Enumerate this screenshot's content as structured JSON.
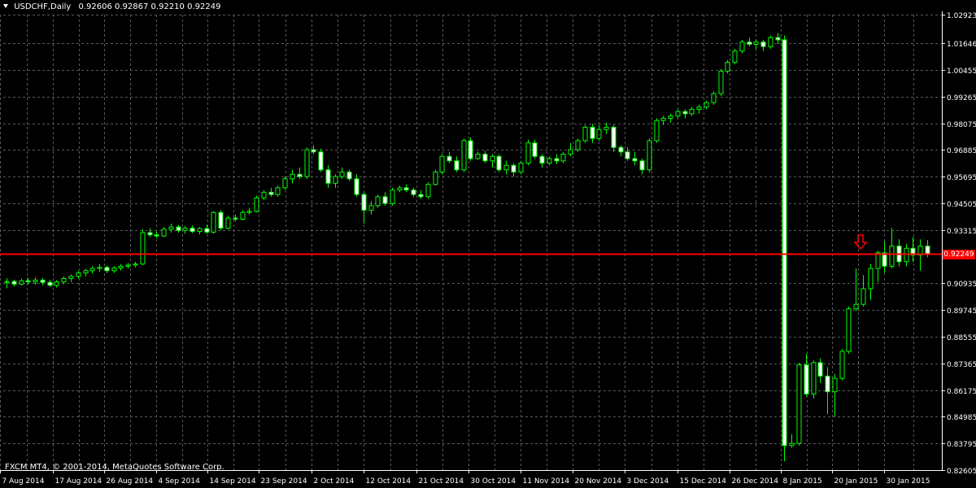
{
  "header": {
    "symbol": "USDCHF,Daily",
    "ohlc": "0.92606 0.92867 0.92210 0.92249"
  },
  "footer": {
    "copyright": "FXCM MT4, © 2001-2014, MetaQuotes Software Corp."
  },
  "colors": {
    "background": "#000000",
    "grid": "#5a5a5a",
    "candle": "#00ff00",
    "bull_body": "#000000",
    "bear_body": "#ffffff",
    "price_line": "#ff0000"
  },
  "price_tag": "0.92249",
  "chart_data": {
    "type": "candlestick",
    "title": "USDCHF,Daily",
    "ylim": [
      0.82605,
      1.02923
    ],
    "y_ticks": [
      "1.02923",
      "1.01646",
      "1.00455",
      "0.99265",
      "0.98075",
      "0.96885",
      "0.95695",
      "0.94505",
      "0.93315",
      "0.92249",
      "0.90935",
      "0.89745",
      "0.88555",
      "0.87365",
      "0.86175",
      "0.84985",
      "0.83795",
      "0.82605"
    ],
    "x_ticks": [
      "7 Aug 2014",
      "17 Aug 2014",
      "26 Aug 2014",
      "4 Sep 2014",
      "14 Sep 2014",
      "23 Sep 2014",
      "2 Oct 2014",
      "12 Oct 2014",
      "21 Oct 2014",
      "30 Oct 2014",
      "11 Nov 2014",
      "20 Nov 2014",
      "3 Dec 2014",
      "15 Dec 2014",
      "26 Dec 2014",
      "8 Jan 2015",
      "20 Jan 2015",
      "30 Jan 2015"
    ],
    "current_price": 0.92249,
    "grid": true,
    "candles": [
      [
        0.9098,
        0.9117,
        0.9072,
        0.9102
      ],
      [
        0.9102,
        0.911,
        0.908,
        0.909
      ],
      [
        0.909,
        0.9115,
        0.9085,
        0.9105
      ],
      [
        0.9105,
        0.9118,
        0.909,
        0.91
      ],
      [
        0.91,
        0.912,
        0.9088,
        0.9108
      ],
      [
        0.9108,
        0.9117,
        0.9085,
        0.9098
      ],
      [
        0.9098,
        0.911,
        0.9078,
        0.9085
      ],
      [
        0.9085,
        0.9108,
        0.9075,
        0.91
      ],
      [
        0.91,
        0.9125,
        0.909,
        0.9115
      ],
      [
        0.9115,
        0.9133,
        0.91,
        0.9125
      ],
      [
        0.9125,
        0.915,
        0.9115,
        0.914
      ],
      [
        0.914,
        0.916,
        0.9125,
        0.915
      ],
      [
        0.915,
        0.917,
        0.9138,
        0.916
      ],
      [
        0.916,
        0.918,
        0.9145,
        0.9165
      ],
      [
        0.9165,
        0.9173,
        0.914,
        0.915
      ],
      [
        0.915,
        0.917,
        0.914,
        0.9162
      ],
      [
        0.9162,
        0.918,
        0.915,
        0.917
      ],
      [
        0.917,
        0.9185,
        0.916,
        0.9175
      ],
      [
        0.9175,
        0.919,
        0.9165,
        0.918
      ],
      [
        0.918,
        0.9335,
        0.9175,
        0.932
      ],
      [
        0.932,
        0.934,
        0.93,
        0.931
      ],
      [
        0.931,
        0.9325,
        0.9295,
        0.9305
      ],
      [
        0.9305,
        0.9345,
        0.93,
        0.9335
      ],
      [
        0.9335,
        0.936,
        0.932,
        0.9345
      ],
      [
        0.9345,
        0.9355,
        0.932,
        0.933
      ],
      [
        0.933,
        0.935,
        0.9315,
        0.934
      ],
      [
        0.934,
        0.9352,
        0.9318,
        0.9325
      ],
      [
        0.9325,
        0.9345,
        0.9312,
        0.9338
      ],
      [
        0.9338,
        0.9355,
        0.9315,
        0.9322
      ],
      [
        0.9322,
        0.9415,
        0.9315,
        0.941
      ],
      [
        0.941,
        0.942,
        0.933,
        0.934
      ],
      [
        0.934,
        0.9395,
        0.9335,
        0.9385
      ],
      [
        0.9385,
        0.94,
        0.937,
        0.938
      ],
      [
        0.938,
        0.942,
        0.9375,
        0.941
      ],
      [
        0.941,
        0.943,
        0.94,
        0.9415
      ],
      [
        0.9415,
        0.9485,
        0.941,
        0.9475
      ],
      [
        0.9475,
        0.951,
        0.9465,
        0.95
      ],
      [
        0.95,
        0.952,
        0.948,
        0.949
      ],
      [
        0.949,
        0.953,
        0.948,
        0.952
      ],
      [
        0.952,
        0.957,
        0.951,
        0.956
      ],
      [
        0.956,
        0.96,
        0.954,
        0.958
      ],
      [
        0.958,
        0.961,
        0.956,
        0.957
      ],
      [
        0.957,
        0.97,
        0.956,
        0.969
      ],
      [
        0.969,
        0.971,
        0.967,
        0.968
      ],
      [
        0.968,
        0.9695,
        0.959,
        0.96
      ],
      [
        0.96,
        0.962,
        0.952,
        0.954
      ],
      [
        0.954,
        0.958,
        0.952,
        0.957
      ],
      [
        0.957,
        0.961,
        0.956,
        0.959
      ],
      [
        0.959,
        0.96,
        0.955,
        0.956
      ],
      [
        0.956,
        0.958,
        0.948,
        0.949
      ],
      [
        0.949,
        0.95,
        0.936,
        0.942
      ],
      [
        0.942,
        0.946,
        0.94,
        0.944
      ],
      [
        0.944,
        0.949,
        0.943,
        0.948
      ],
      [
        0.948,
        0.95,
        0.944,
        0.945
      ],
      [
        0.945,
        0.952,
        0.944,
        0.951
      ],
      [
        0.951,
        0.953,
        0.95,
        0.952
      ],
      [
        0.952,
        0.9535,
        0.95,
        0.951
      ],
      [
        0.951,
        0.952,
        0.948,
        0.949
      ],
      [
        0.949,
        0.951,
        0.947,
        0.948
      ],
      [
        0.948,
        0.9545,
        0.947,
        0.9535
      ],
      [
        0.9535,
        0.96,
        0.953,
        0.959
      ],
      [
        0.959,
        0.967,
        0.958,
        0.966
      ],
      [
        0.966,
        0.968,
        0.963,
        0.964
      ],
      [
        0.964,
        0.966,
        0.959,
        0.96
      ],
      [
        0.96,
        0.974,
        0.959,
        0.973
      ],
      [
        0.973,
        0.9745,
        0.964,
        0.965
      ],
      [
        0.965,
        0.968,
        0.9645,
        0.967
      ],
      [
        0.967,
        0.9685,
        0.963,
        0.964
      ],
      [
        0.964,
        0.967,
        0.961,
        0.966
      ],
      [
        0.966,
        0.967,
        0.959,
        0.96
      ],
      [
        0.96,
        0.964,
        0.958,
        0.962
      ],
      [
        0.962,
        0.963,
        0.957,
        0.959
      ],
      [
        0.959,
        0.964,
        0.958,
        0.963
      ],
      [
        0.963,
        0.9735,
        0.962,
        0.972
      ],
      [
        0.972,
        0.9735,
        0.965,
        0.966
      ],
      [
        0.966,
        0.967,
        0.961,
        0.963
      ],
      [
        0.963,
        0.966,
        0.962,
        0.965
      ],
      [
        0.965,
        0.967,
        0.9625,
        0.964
      ],
      [
        0.964,
        0.968,
        0.963,
        0.967
      ],
      [
        0.967,
        0.972,
        0.966,
        0.969
      ],
      [
        0.969,
        0.974,
        0.968,
        0.973
      ],
      [
        0.973,
        0.98,
        0.972,
        0.979
      ],
      [
        0.979,
        0.9805,
        0.972,
        0.974
      ],
      [
        0.974,
        0.98,
        0.973,
        0.978
      ],
      [
        0.978,
        0.981,
        0.976,
        0.979
      ],
      [
        0.979,
        0.98,
        0.968,
        0.97
      ],
      [
        0.97,
        0.971,
        0.966,
        0.968
      ],
      [
        0.968,
        0.97,
        0.964,
        0.965
      ],
      [
        0.965,
        0.968,
        0.962,
        0.964
      ],
      [
        0.964,
        0.965,
        0.958,
        0.96
      ],
      [
        0.96,
        0.974,
        0.959,
        0.973
      ],
      [
        0.973,
        0.983,
        0.972,
        0.982
      ],
      [
        0.982,
        0.984,
        0.98,
        0.983
      ],
      [
        0.983,
        0.985,
        0.981,
        0.984
      ],
      [
        0.984,
        0.987,
        0.983,
        0.986
      ],
      [
        0.986,
        0.987,
        0.983,
        0.985
      ],
      [
        0.985,
        0.988,
        0.984,
        0.987
      ],
      [
        0.987,
        0.989,
        0.985,
        0.988
      ],
      [
        0.988,
        0.991,
        0.987,
        0.99
      ],
      [
        0.99,
        0.995,
        0.989,
        0.994
      ],
      [
        0.994,
        1.005,
        0.993,
        1.004
      ],
      [
        1.004,
        1.009,
        1.003,
        1.008
      ],
      [
        1.008,
        1.014,
        1.007,
        1.013
      ],
      [
        1.013,
        1.018,
        1.012,
        1.017
      ],
      [
        1.017,
        1.019,
        1.015,
        1.016
      ],
      [
        1.016,
        1.018,
        1.014,
        1.017
      ],
      [
        1.017,
        1.018,
        1.013,
        1.015
      ],
      [
        1.015,
        1.02,
        1.014,
        1.019
      ],
      [
        1.019,
        1.021,
        1.016,
        1.018
      ],
      [
        1.018,
        1.02,
        0.83,
        0.837
      ],
      [
        0.837,
        0.842,
        0.836,
        0.838
      ],
      [
        0.838,
        0.874,
        0.837,
        0.873
      ],
      [
        0.873,
        0.878,
        0.859,
        0.86
      ],
      [
        0.86,
        0.875,
        0.858,
        0.874
      ],
      [
        0.874,
        0.876,
        0.865,
        0.868
      ],
      [
        0.868,
        0.872,
        0.851,
        0.861
      ],
      [
        0.861,
        0.869,
        0.85,
        0.867
      ],
      [
        0.867,
        0.88,
        0.866,
        0.879
      ],
      [
        0.879,
        0.899,
        0.878,
        0.898
      ],
      [
        0.898,
        0.916,
        0.897,
        0.9
      ],
      [
        0.9,
        0.913,
        0.899,
        0.907
      ],
      [
        0.907,
        0.918,
        0.902,
        0.916
      ],
      [
        0.916,
        0.924,
        0.91,
        0.923
      ],
      [
        0.923,
        0.928,
        0.914,
        0.917
      ],
      [
        0.917,
        0.934,
        0.916,
        0.926
      ],
      [
        0.926,
        0.929,
        0.917,
        0.919
      ],
      [
        0.919,
        0.927,
        0.917,
        0.925
      ],
      [
        0.925,
        0.93,
        0.919,
        0.922
      ],
      [
        0.922,
        0.929,
        0.915,
        0.926
      ],
      [
        0.926,
        0.9287,
        0.921,
        0.9225
      ]
    ]
  }
}
